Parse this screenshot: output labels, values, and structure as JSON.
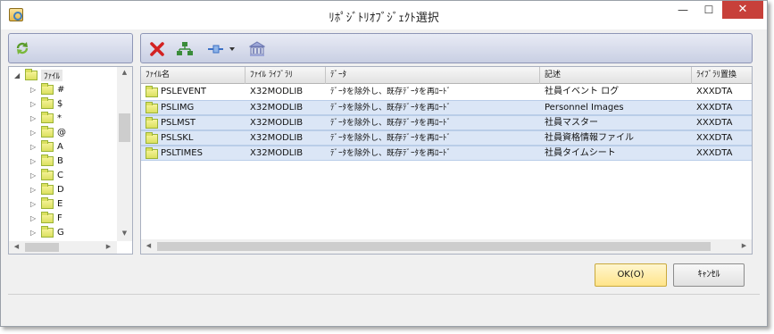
{
  "window": {
    "title": "ﾘﾎﾟｼﾞﾄﾘｵﾌﾞｼﾞｪｸﾄ選択",
    "minimize": "—",
    "maximize": "☐",
    "close": "✕"
  },
  "left": {
    "toolbar": {
      "refresh_icon": "refresh-icon"
    },
    "tree": {
      "root_label": "ﾌｧｲﾙ",
      "items": [
        "#",
        "$",
        "*",
        "@",
        "A",
        "B",
        "C",
        "D",
        "E",
        "F",
        "G"
      ]
    }
  },
  "right": {
    "toolbar": {
      "delete_icon": "red-x-delete-icon",
      "hierarchy_icon": "hierarchy-icon",
      "connect_icon": "connector-dropdown-icon",
      "library_icon": "library-building-icon"
    },
    "grid": {
      "columns": [
        "ﾌｧｲﾙ名",
        "ﾌｧｲﾙ ﾗｲﾌﾞﾗﾘ",
        "ﾃﾞｰﾀ",
        "記述",
        "ﾗｲﾌﾞﾗﾘ置換"
      ],
      "rows": [
        {
          "name": "PSLEVENT",
          "library": "X32MODLIB",
          "data": "ﾃﾞｰﾀを除外し、既存ﾃﾞｰﾀを再ﾛｰﾄﾞ",
          "description": "社員イベント ログ",
          "replace": "XXXDTA"
        },
        {
          "name": "PSLIMG",
          "library": "X32MODLIB",
          "data": "ﾃﾞｰﾀを除外し、既存ﾃﾞｰﾀを再ﾛｰﾄﾞ",
          "description": "Personnel Images",
          "replace": "XXXDTA"
        },
        {
          "name": "PSLMST",
          "library": "X32MODLIB",
          "data": "ﾃﾞｰﾀを除外し、既存ﾃﾞｰﾀを再ﾛｰﾄﾞ",
          "description": "社員マスター",
          "replace": "XXXDTA"
        },
        {
          "name": "PSLSKL",
          "library": "X32MODLIB",
          "data": "ﾃﾞｰﾀを除外し、既存ﾃﾞｰﾀを再ﾛｰﾄﾞ",
          "description": "社員資格情報ファイル",
          "replace": "XXXDTA"
        },
        {
          "name": "PSLTIMES",
          "library": "X32MODLIB",
          "data": "ﾃﾞｰﾀを除外し、既存ﾃﾞｰﾀを再ﾛｰﾄﾞ",
          "description": "社員タイムシート",
          "replace": "XXXDTA"
        }
      ]
    }
  },
  "buttons": {
    "ok": "OK(O)",
    "cancel": "ｷｬﾝｾﾙ"
  },
  "colors": {
    "selected_row": "#dbe6f6",
    "ok_button": "#ffe489",
    "close_button": "#c7403a"
  }
}
